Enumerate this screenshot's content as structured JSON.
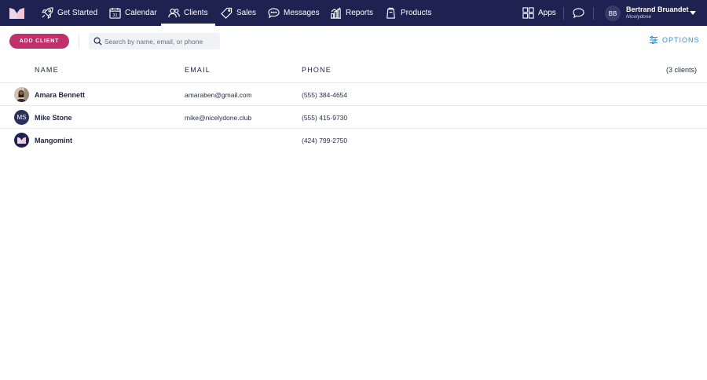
{
  "nav": {
    "items": [
      {
        "label": "Get Started",
        "icon": "rocket-icon"
      },
      {
        "label": "Calendar",
        "icon": "calendar-icon",
        "calendar_day": "31"
      },
      {
        "label": "Clients",
        "icon": "clients-icon",
        "active": true
      },
      {
        "label": "Sales",
        "icon": "tag-icon"
      },
      {
        "label": "Messages",
        "icon": "message-bubble-icon"
      },
      {
        "label": "Reports",
        "icon": "bar-chart-icon"
      },
      {
        "label": "Products",
        "icon": "box-icon"
      }
    ],
    "apps_label": "Apps",
    "user": {
      "initials": "BB",
      "name": "Bertrand Bruandet",
      "org": "Nicelydone"
    }
  },
  "toolbar": {
    "add_client_label": "ADD CLIENT",
    "search_placeholder": "Search by name, email, or phone",
    "search_value": "",
    "options_label": "OPTIONS"
  },
  "table": {
    "columns": {
      "name": "NAME",
      "email": "EMAIL",
      "phone": "PHONE"
    },
    "count_label": "(3 clients)",
    "rows": [
      {
        "name": "Amara Bennett",
        "email": "amaraben@gmail.com",
        "phone": "(555) 384-4654",
        "avatar_type": "photo"
      },
      {
        "name": "Mike Stone",
        "email": "mike@nicelydone.club",
        "phone": "(555) 415-9730",
        "avatar_type": "initials",
        "initials": "MS"
      },
      {
        "name": "Mangomint",
        "email": "",
        "phone": "(424) 799-2750",
        "avatar_type": "logo"
      }
    ]
  },
  "colors": {
    "topbar": "#1d2251",
    "accent_pink": "#c0306c",
    "options_blue": "#2f8fc8"
  }
}
